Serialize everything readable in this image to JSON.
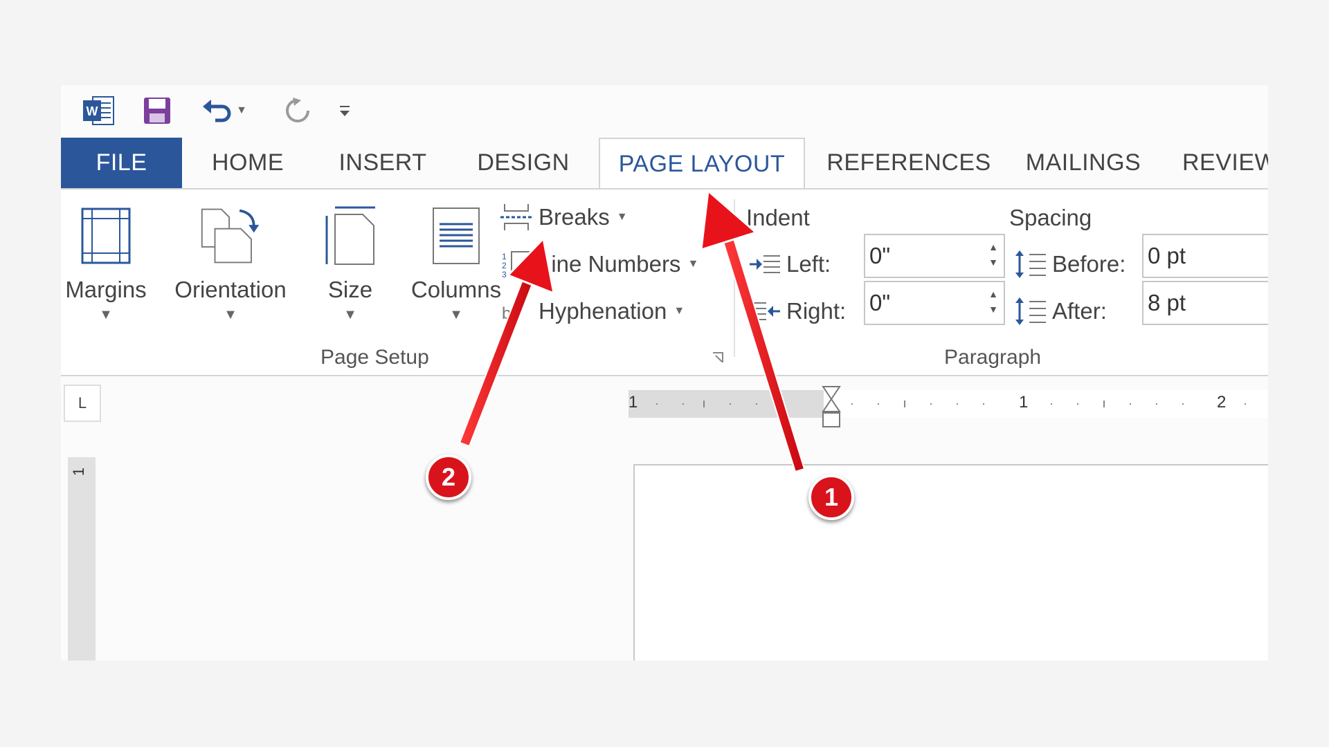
{
  "qat": {
    "word_icon": "word-logo-icon",
    "save_icon": "save-icon",
    "undo_icon": "undo-icon",
    "redo_icon": "redo-icon",
    "customize_icon": "customize-qat-icon"
  },
  "tabs": [
    {
      "label": "FILE"
    },
    {
      "label": "HOME"
    },
    {
      "label": "INSERT"
    },
    {
      "label": "DESIGN"
    },
    {
      "label": "PAGE LAYOUT"
    },
    {
      "label": "REFERENCES"
    },
    {
      "label": "MAILINGS"
    },
    {
      "label": "REVIEW"
    }
  ],
  "page_setup": {
    "margins": "Margins",
    "orientation": "Orientation",
    "size": "Size",
    "columns": "Columns",
    "breaks": "Breaks",
    "line_numbers": "Line Numbers",
    "hyphenation": "Hyphenation",
    "group_label": "Page Setup"
  },
  "paragraph": {
    "indent_title": "Indent",
    "left_label": "Left:",
    "left_value": "0\"",
    "right_label": "Right:",
    "right_value": "0\"",
    "spacing_title": "Spacing",
    "before_label": "Before:",
    "before_value": "0 pt",
    "after_label": "After:",
    "after_value": "8 pt",
    "group_label": "Paragraph"
  },
  "ruler": {
    "tab_selector": "L",
    "h_numbers": [
      "1",
      "1",
      "2"
    ],
    "v_number": "1"
  },
  "annotations": {
    "badge1": "1",
    "badge2": "2",
    "color": "#d9131c"
  },
  "colors": {
    "accent": "#2b579a",
    "annotation_red": "#e8121b"
  }
}
